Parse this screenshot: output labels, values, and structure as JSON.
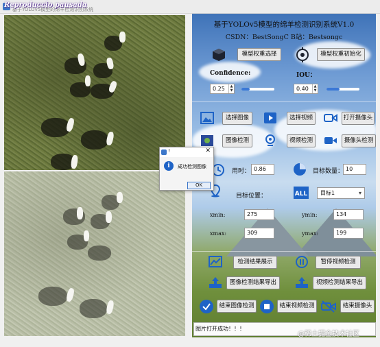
{
  "window": {
    "title_overlay": "Reproduccio pausada",
    "title_faint": "基于YOLOv5模型的绵羊检测识别系统"
  },
  "panel": {
    "title": "基于YOLOv5模型的绵羊检测识别系统V1.0",
    "subtitle": "CSDN：BestSongC    B站：Bestsongc",
    "model_select_button": "模型权重选择",
    "model_init_button": "模型权重初始化",
    "confidence_label": "Confidence:",
    "confidence_value": "0.25",
    "confidence_level": 0.25,
    "iou_label": "IOU：",
    "iou_value": "0.40",
    "iou_level": 0.4,
    "select_image_button": "选择图像",
    "select_video_button": "选择视频",
    "open_camera_button": "打开摄像头",
    "image_detect_button": "图像检测",
    "video_detect_button": "视频检测",
    "camera_detect_button": "摄像头检测",
    "time_label": "用时：",
    "time_value": "0.86",
    "target_count_label": "目标数量：",
    "target_count_value": "10",
    "target_position_label": "目标位置：",
    "target_select_value": "目标1",
    "xmin_label": "xmin:",
    "xmin_value": "275",
    "ymin_label": "ymin:",
    "ymin_value": "134",
    "xmax_label": "xmax:",
    "xmax_value": "309",
    "ymax_label": "ymax:",
    "ymax_value": "199",
    "show_results_button": "检测结果展示",
    "pause_video_button": "暂停视频检测",
    "export_image_results_button": "图像检测结果导出",
    "export_video_results_button": "视频检测结果导出",
    "end_image_detect_button": "结束图像检测",
    "end_video_detect_button": "结束视频检测",
    "end_camera_button": "结束摄像头",
    "status_text": "图片打开成功！！！"
  },
  "dialog": {
    "title": "!",
    "close": "✕",
    "info_glyph": "i",
    "message": "成功检测图像",
    "ok_button": "OK"
  },
  "watermark": "@稀土掘金技术社区",
  "colors": {
    "accent": "#3b78d6",
    "panel_sky": "#6d9ad3",
    "panel_grass": "#6f8f3c"
  },
  "icons": {
    "model_cube": "cube-icon",
    "model_init": "target-icon",
    "select_image": "image-icon",
    "select_video": "video-icon",
    "camera": "camera-icon",
    "time": "clock-icon",
    "count": "pie-chart-icon",
    "position": "location-pin-icon",
    "all": "all-badge-icon",
    "results": "chart-icon",
    "pause": "pause-icon",
    "export": "upload-icon",
    "end_image": "check-circle-icon",
    "end_video": "stop-icon",
    "end_camera": "camera-off-icon"
  }
}
